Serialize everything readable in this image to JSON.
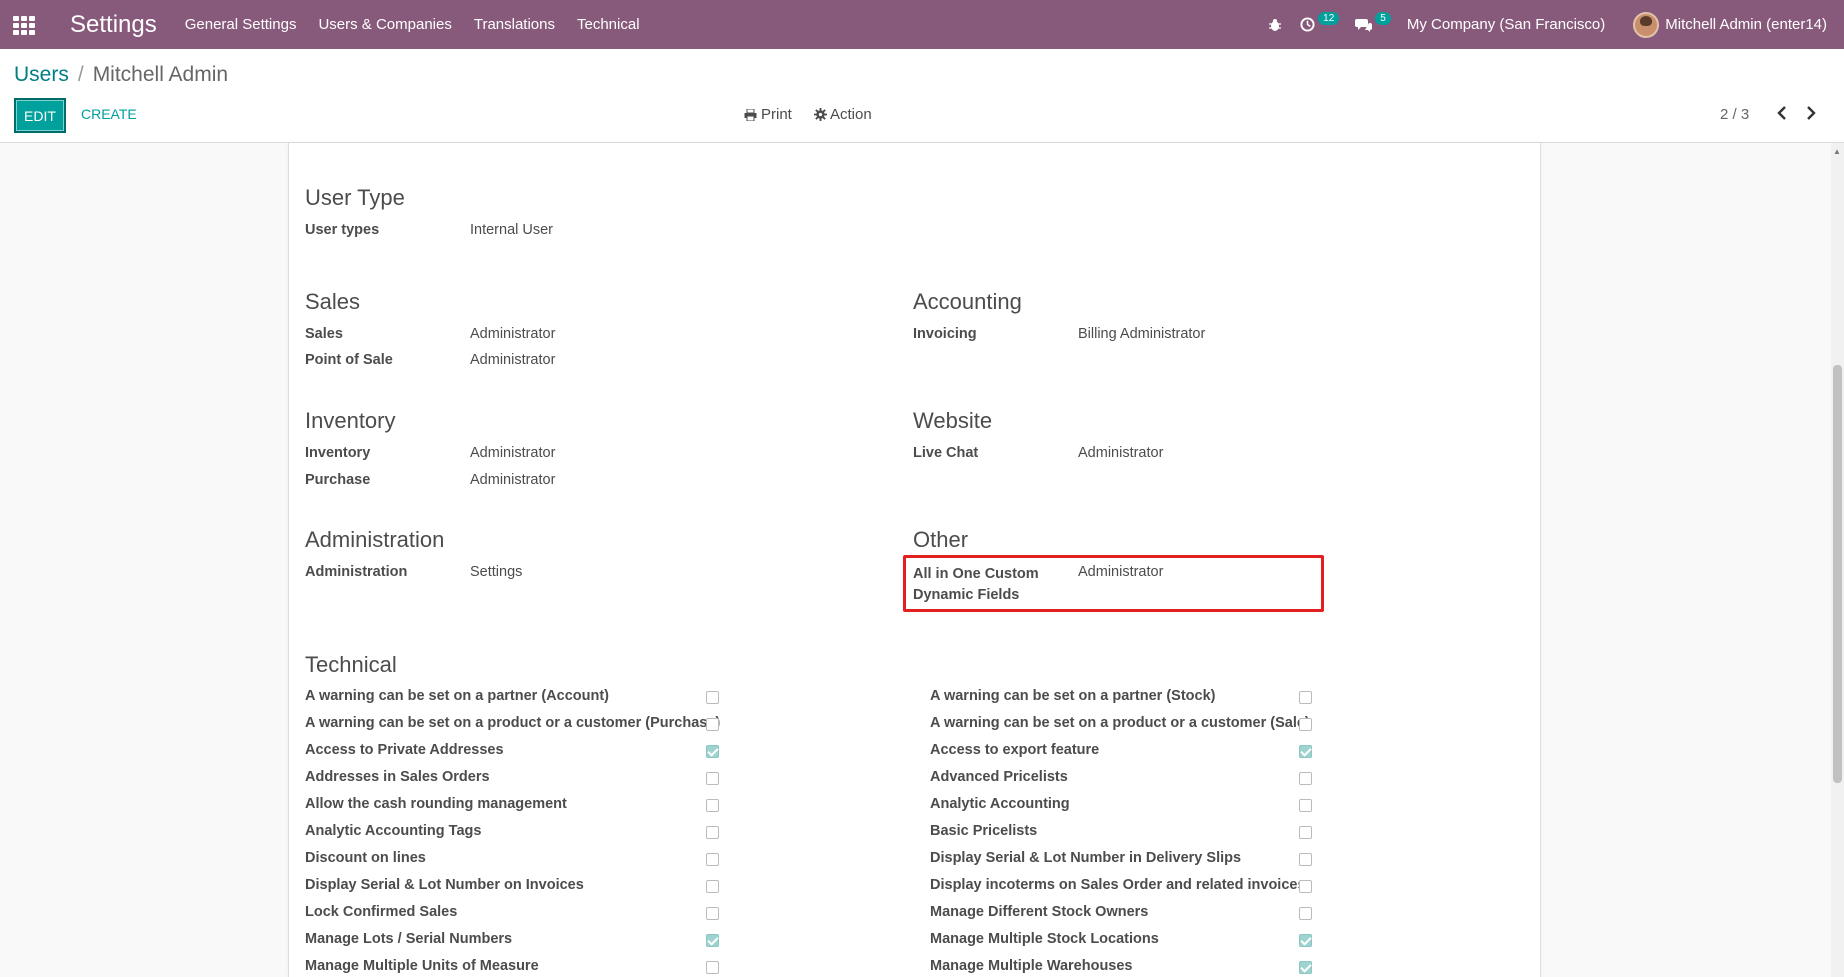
{
  "navbar": {
    "app_title": "Settings",
    "menu": [
      "General Settings",
      "Users & Companies",
      "Translations",
      "Technical"
    ],
    "activity_count": "12",
    "messages_count": "5",
    "company": "My Company (San Francisco)",
    "user": "Mitchell Admin (enter14)"
  },
  "control": {
    "breadcrumb_root": "Users",
    "breadcrumb_sep": "/",
    "breadcrumb_current": "Mitchell Admin",
    "edit_label": "EDIT",
    "create_label": "CREATE",
    "print_label": "Print",
    "action_label": "Action",
    "pager": "2 / 3"
  },
  "form": {
    "user_type": {
      "title": "User Type",
      "label": "User types",
      "value": "Internal User"
    },
    "sales": {
      "title": "Sales",
      "fields": [
        {
          "label": "Sales",
          "value": "Administrator"
        },
        {
          "label": "Point of Sale",
          "value": "Administrator"
        }
      ]
    },
    "accounting": {
      "title": "Accounting",
      "fields": [
        {
          "label": "Invoicing",
          "value": "Billing Administrator"
        }
      ]
    },
    "inventory": {
      "title": "Inventory",
      "fields": [
        {
          "label": "Inventory",
          "value": "Administrator"
        },
        {
          "label": "Purchase",
          "value": "Administrator"
        }
      ]
    },
    "website": {
      "title": "Website",
      "fields": [
        {
          "label": "Live Chat",
          "value": "Administrator"
        }
      ]
    },
    "administration": {
      "title": "Administration",
      "fields": [
        {
          "label": "Administration",
          "value": "Settings"
        }
      ]
    },
    "other": {
      "title": "Other",
      "label_line1": "All in One Custom",
      "label_line2": "Dynamic Fields",
      "value": "Administrator"
    },
    "technical": {
      "title": "Technical",
      "left": [
        {
          "label": "A warning can be set on a partner (Account)",
          "checked": false
        },
        {
          "label": "A warning can be set on a product or a customer (Purchase)",
          "checked": false
        },
        {
          "label": "Access to Private Addresses",
          "checked": true
        },
        {
          "label": "Addresses in Sales Orders",
          "checked": false
        },
        {
          "label": "Allow the cash rounding management",
          "checked": false
        },
        {
          "label": "Analytic Accounting Tags",
          "checked": false
        },
        {
          "label": "Discount on lines",
          "checked": false
        },
        {
          "label": "Display Serial & Lot Number on Invoices",
          "checked": false
        },
        {
          "label": "Lock Confirmed Sales",
          "checked": false
        },
        {
          "label": "Manage Lots / Serial Numbers",
          "checked": true
        },
        {
          "label": "Manage Multiple Units of Measure",
          "checked": false
        }
      ],
      "right": [
        {
          "label": "A warning can be set on a partner (Stock)",
          "checked": false
        },
        {
          "label": "A warning can be set on a product or a customer (Sale)",
          "checked": false
        },
        {
          "label": "Access to export feature",
          "checked": true
        },
        {
          "label": "Advanced Pricelists",
          "checked": false
        },
        {
          "label": "Analytic Accounting",
          "checked": false
        },
        {
          "label": "Basic Pricelists",
          "checked": false
        },
        {
          "label": "Display Serial & Lot Number in Delivery Slips",
          "checked": false
        },
        {
          "label": "Display incoterms on Sales Order and related invoices",
          "checked": false
        },
        {
          "label": "Manage Different Stock Owners",
          "checked": false
        },
        {
          "label": "Manage Multiple Stock Locations",
          "checked": true
        },
        {
          "label": "Manage Multiple Warehouses",
          "checked": true
        }
      ]
    }
  },
  "colors": {
    "navbar": "#875a7b",
    "primary": "#00a09d",
    "link": "#017e84",
    "highlight": "#e32020"
  }
}
